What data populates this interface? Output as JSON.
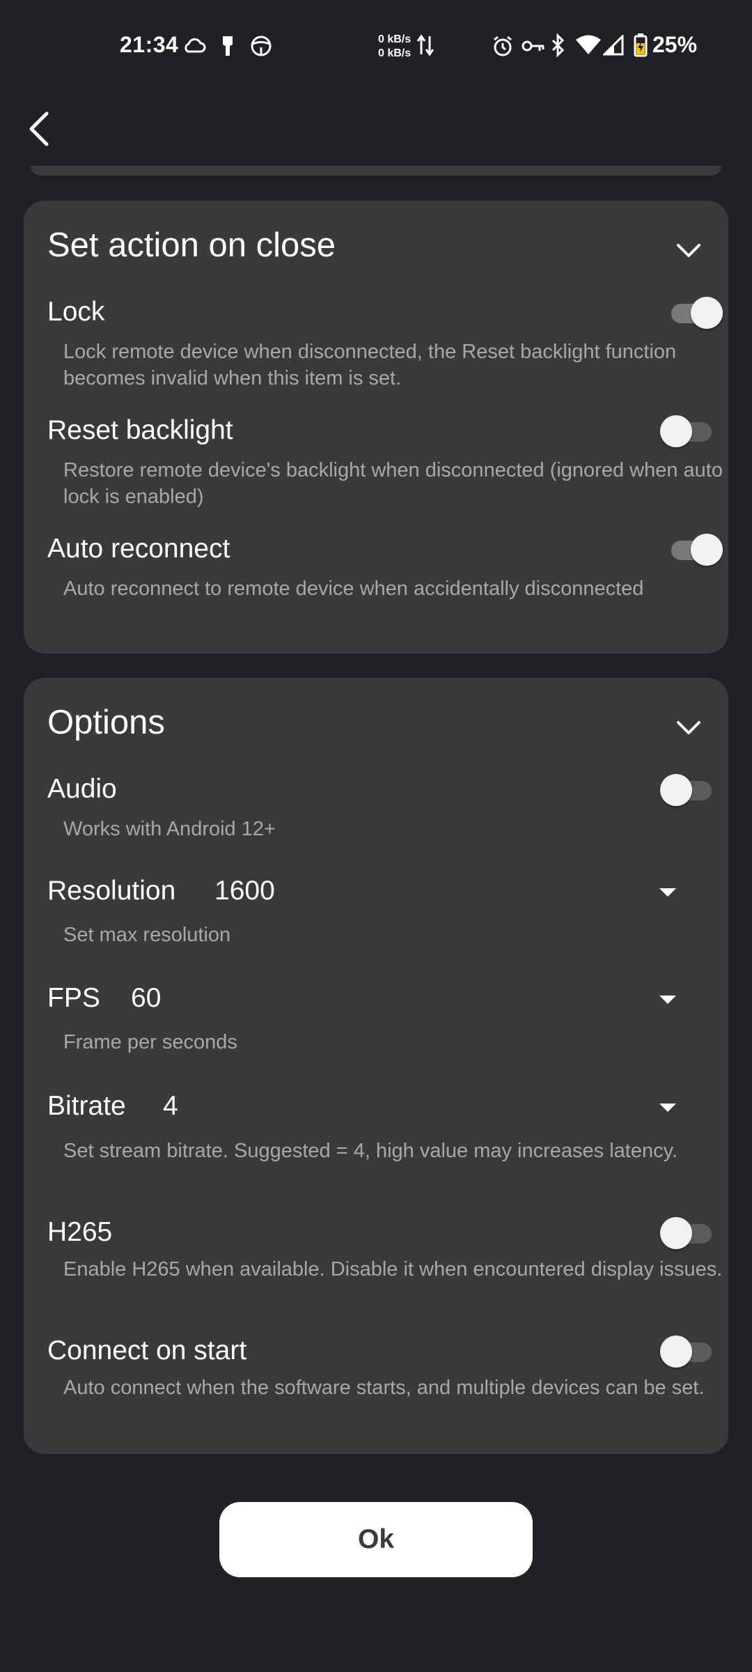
{
  "status_bar": {
    "time": "21:34",
    "net_up": "0 kB/s",
    "net_down": "0 kB/s",
    "battery": "25%",
    "icons": [
      "cloud-icon",
      "brush-icon",
      "steering-icon",
      "data-arrows-icon",
      "alarm-icon",
      "vpn-key-icon",
      "bluetooth-icon",
      "wifi-icon",
      "signal-icon",
      "battery-icon"
    ]
  },
  "close_section": {
    "title": "Set action on close",
    "rows": [
      {
        "title": "Lock",
        "desc": "Lock remote device when disconnected, the Reset backlight function becomes invalid when this item is set.",
        "enabled": true
      },
      {
        "title": "Reset backlight",
        "desc": "Restore remote device's backlight when disconnected (ignored when auto lock is enabled)",
        "enabled": false
      },
      {
        "title": "Auto reconnect",
        "desc": "Auto reconnect to remote device when accidentally disconnected",
        "enabled": true
      }
    ]
  },
  "options_section": {
    "title": "Options",
    "audio": {
      "title": "Audio",
      "desc": "Works with Android 12+",
      "enabled": false
    },
    "resolution": {
      "title": "Resolution",
      "value": "1600",
      "desc": "Set max resolution"
    },
    "fps": {
      "title": "FPS",
      "value": "60",
      "desc": "Frame per seconds"
    },
    "bitrate": {
      "title": "Bitrate",
      "value": "4",
      "desc": "Set stream bitrate. Suggested = 4, high value may increases latency."
    },
    "h265": {
      "title": "H265",
      "desc": "Enable H265 when available. Disable it when encountered display issues.",
      "enabled": false
    },
    "connect_on_start": {
      "title": "Connect on start",
      "desc": "Auto connect when the software starts, and multiple devices can be set.",
      "enabled": false
    }
  },
  "ok_label": "Ok"
}
